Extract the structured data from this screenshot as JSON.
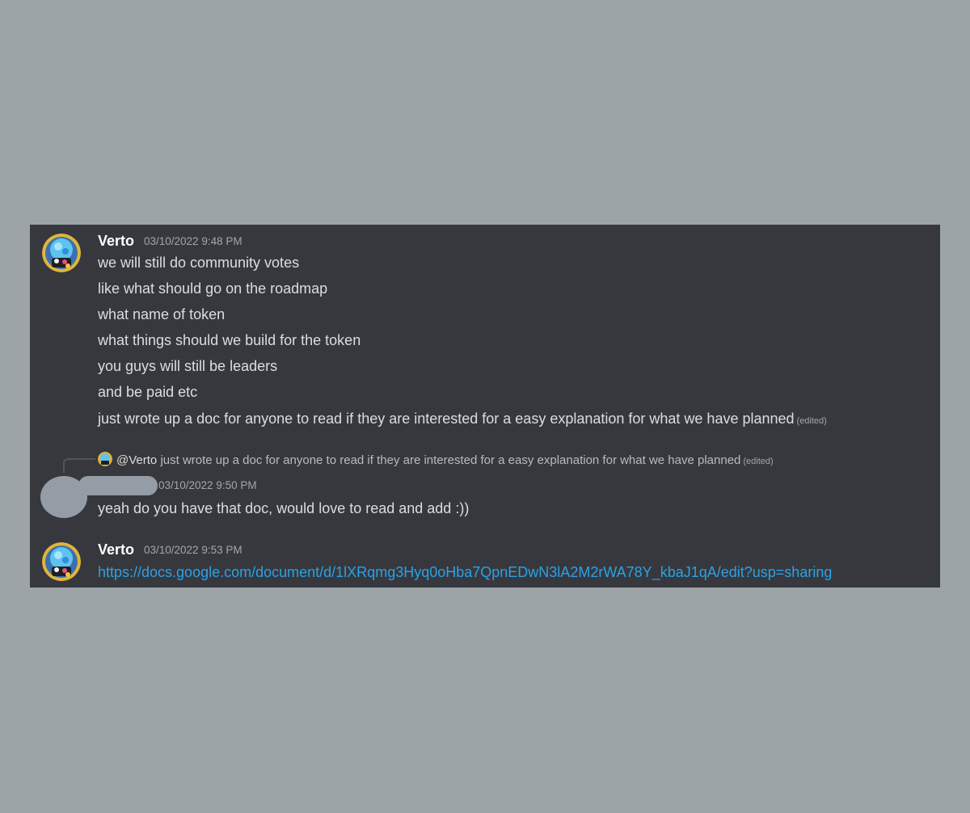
{
  "messages": [
    {
      "author": "Verto",
      "timestamp": "03/10/2022 9:48 PM",
      "lines": [
        "we will still do community votes",
        "like what should go on the roadmap",
        "what name of token",
        "what things should we build for the token",
        "you guys will still be leaders",
        "and be paid etc",
        "just wrote up a doc for anyone to read if they are interested for a easy explanation for what we have planned"
      ],
      "edited": "(edited)"
    },
    {
      "reply": {
        "author": "@Verto",
        "text": "just wrote up a doc for anyone to read if they are interested for a easy explanation for what we have planned",
        "edited": "(edited)"
      },
      "author": "",
      "timestamp": "03/10/2022 9:50 PM",
      "text": "yeah do you have that doc, would love to read and add :))"
    },
    {
      "author": "Verto",
      "timestamp": "03/10/2022 9:53 PM",
      "link": "https://docs.google.com/document/d/1lXRqmg3Hyq0oHba7QpnEDwN3lA2M2rWA78Y_kbaJ1qA/edit?usp=sharing"
    }
  ],
  "colors": {
    "page_background": "#9ca4a7",
    "panel_background": "#37383d",
    "link": "#2aa2e6",
    "redaction": "#949ca6"
  },
  "icons": {
    "verto_avatar": "avatar-icon",
    "redacted_avatar": "redacted-avatar"
  }
}
